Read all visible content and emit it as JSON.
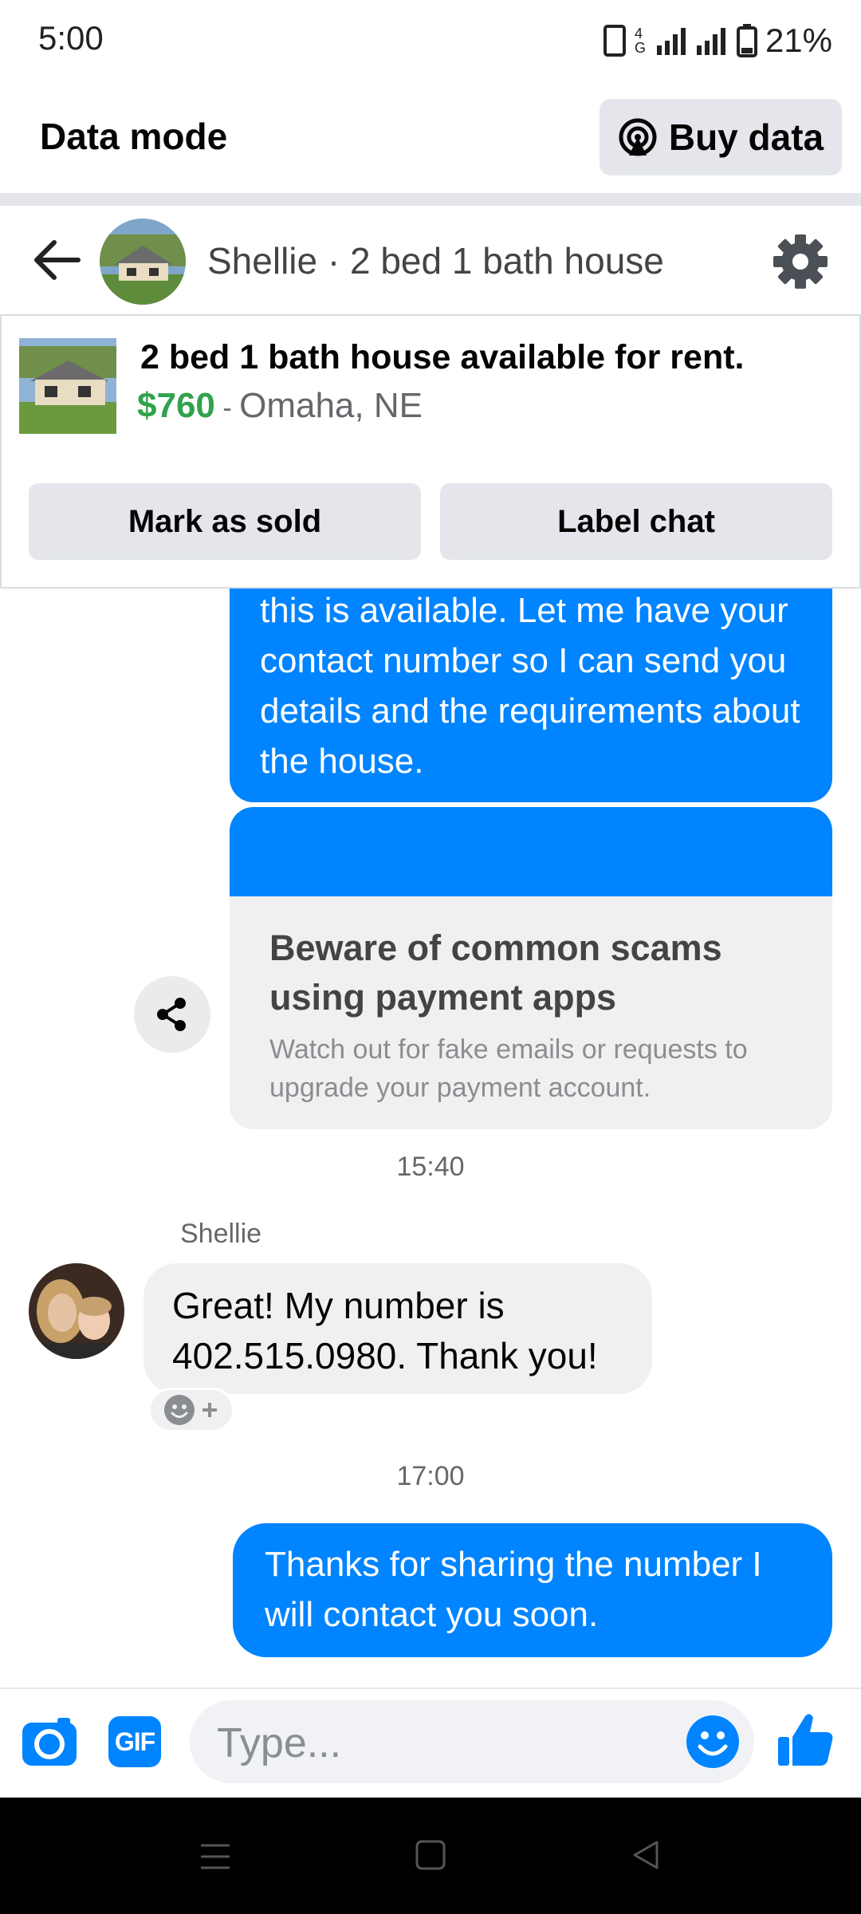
{
  "status_bar": {
    "time": "5:00",
    "network": "4G",
    "battery": "21%"
  },
  "data_mode": {
    "title": "Data mode",
    "buy_label": "Buy data"
  },
  "header": {
    "title": "Shellie · 2 bed 1 bath house"
  },
  "listing": {
    "title": "2 bed 1 bath house available for rent.",
    "price": "$760",
    "separator": " - ",
    "location": "Omaha, NE",
    "mark_sold_label": "Mark as sold",
    "label_chat_label": "Label chat"
  },
  "messages": {
    "outgoing_1": "this is available. Let me have your contact number so I can send you details and the requirements about the house.",
    "scam_title": "Beware of common scams using payment apps",
    "scam_desc": "Watch out for fake emails or requests to upgrade your payment account.",
    "time_1": "15:40",
    "sender_name": "Shellie",
    "incoming_1": "Great!  My number is 402.515.0980.  Thank you!",
    "time_2": "17:00",
    "outgoing_2": "Thanks for sharing the number I will contact you soon."
  },
  "composer": {
    "placeholder": "Type...",
    "gif_label": "GIF"
  },
  "colors": {
    "messenger_blue": "#0084ff",
    "price_green": "#31a24c",
    "bubble_gray": "#f0f0f0"
  }
}
